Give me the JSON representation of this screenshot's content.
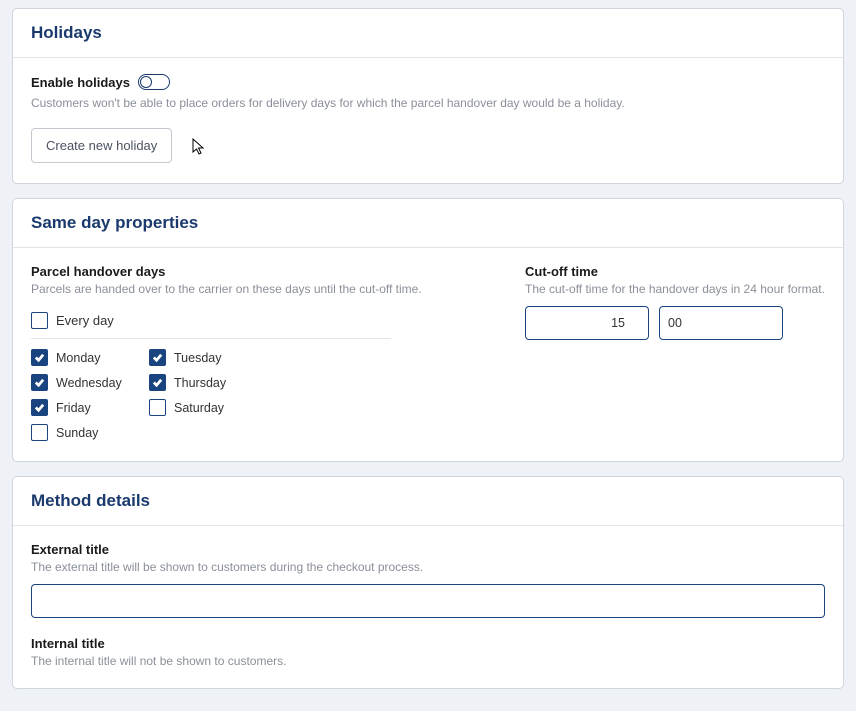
{
  "holidays": {
    "title": "Holidays",
    "enable_label": "Enable holidays",
    "enabled": false,
    "description": "Customers won't be able to place orders for delivery days for which the parcel handover day would be a holiday.",
    "create_button": "Create new holiday"
  },
  "same_day": {
    "title": "Same day properties",
    "handover": {
      "label": "Parcel handover days",
      "description": "Parcels are handed over to the carrier on these days until the cut-off time.",
      "every_day_label": "Every day",
      "every_day_checked": false,
      "days": [
        {
          "label": "Monday",
          "checked": true
        },
        {
          "label": "Tuesday",
          "checked": true
        },
        {
          "label": "Wednesday",
          "checked": true
        },
        {
          "label": "Thursday",
          "checked": true
        },
        {
          "label": "Friday",
          "checked": true
        },
        {
          "label": "Saturday",
          "checked": false
        },
        {
          "label": "Sunday",
          "checked": false
        }
      ]
    },
    "cutoff": {
      "label": "Cut-off time",
      "description": "The cut-off time for the handover days in 24 hour format.",
      "hours": "15",
      "minutes": "00"
    }
  },
  "method": {
    "title": "Method details",
    "external": {
      "label": "External title",
      "description": "The external title will be shown to customers during the checkout process.",
      "value": ""
    },
    "internal": {
      "label": "Internal title",
      "description": "The internal title will not be shown to customers.",
      "value": ""
    }
  }
}
